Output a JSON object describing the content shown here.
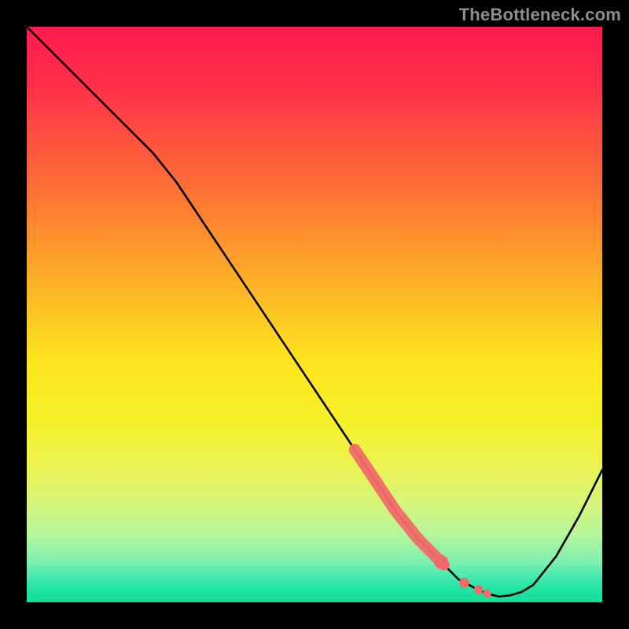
{
  "watermark": "TheBottleneck.com",
  "colors": {
    "curve": "#000000",
    "marker_fill": "#f26a6a",
    "marker_stroke": "#d94f4f",
    "background_black": "#000000"
  },
  "chart_data": {
    "type": "line",
    "title": "",
    "xlabel": "",
    "ylabel": "",
    "xlim": [
      0,
      100
    ],
    "ylim": [
      0,
      100
    ],
    "grid": false,
    "legend": "none",
    "description": "Bottleneck-percentage curve on a rainbow gradient. High values (bad) are at the top-red region; minimum (optimal) occurs near x≈82 at the bottom-green region.",
    "series": [
      {
        "name": "bottleneck_curve",
        "x": [
          0,
          6,
          12,
          18,
          22,
          26,
          30,
          36,
          42,
          48,
          54,
          60,
          64,
          68,
          72,
          75,
          78,
          80,
          82,
          84,
          86,
          88,
          92,
          96,
          100
        ],
        "values": [
          100,
          94,
          88,
          82,
          78,
          73,
          67,
          58,
          49,
          40,
          31,
          22,
          16,
          11,
          7,
          4,
          2.4,
          1.5,
          1.0,
          1.2,
          1.8,
          3,
          8,
          15,
          23
        ]
      }
    ],
    "highlighted_points": {
      "name": "highlighted_region",
      "comment": "Thick coral segment and dots — emphasized near-optimal cluster",
      "segment": {
        "x_start": 57,
        "x_end": 72
      },
      "dots_x": [
        72.5,
        76,
        78.5,
        80
      ],
      "dots_y": [
        6.5,
        3.4,
        2.2,
        1.5
      ]
    }
  }
}
